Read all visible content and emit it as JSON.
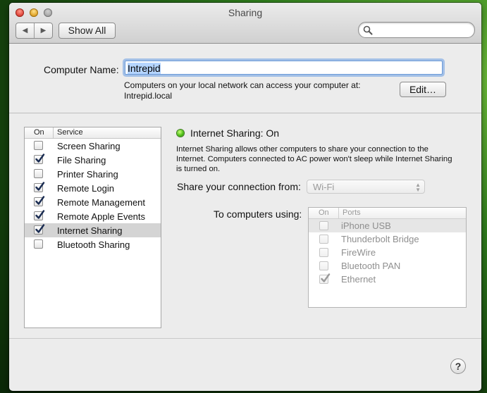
{
  "window": {
    "title": "Sharing"
  },
  "toolbar": {
    "back_icon": "back-arrow",
    "forward_icon": "forward-arrow",
    "show_all_label": "Show All",
    "search": {
      "value": "",
      "placeholder": ""
    }
  },
  "computer": {
    "label": "Computer Name:",
    "name": "Intrepid",
    "access_line1": "Computers on your local network can access your computer at:",
    "access_line2": "Intrepid.local",
    "edit_label": "Edit…"
  },
  "services": {
    "header_on": "On",
    "header_service": "Service",
    "items": [
      {
        "label": "Screen Sharing",
        "checked": false,
        "selected": false
      },
      {
        "label": "File Sharing",
        "checked": true,
        "selected": false
      },
      {
        "label": "Printer Sharing",
        "checked": false,
        "selected": false
      },
      {
        "label": "Remote Login",
        "checked": true,
        "selected": false
      },
      {
        "label": "Remote Management",
        "checked": true,
        "selected": false
      },
      {
        "label": "Remote Apple Events",
        "checked": true,
        "selected": false
      },
      {
        "label": "Internet Sharing",
        "checked": true,
        "selected": true
      },
      {
        "label": "Bluetooth Sharing",
        "checked": false,
        "selected": false
      }
    ]
  },
  "detail": {
    "status_title": "Internet Sharing: On",
    "status_color": "#4fbf18",
    "description": "Internet Sharing allows other computers to share your connection to the Internet. Computers connected to AC power won't sleep while Internet Sharing is turned on.",
    "share_from_label": "Share your connection from:",
    "share_from_value": "Wi-Fi",
    "to_computers_label": "To computers using:",
    "ports_header_on": "On",
    "ports_header_ports": "Ports",
    "ports": [
      {
        "label": "iPhone USB",
        "checked": false,
        "selected": true
      },
      {
        "label": "Thunderbolt Bridge",
        "checked": false,
        "selected": false
      },
      {
        "label": "FireWire",
        "checked": false,
        "selected": false
      },
      {
        "label": "Bluetooth PAN",
        "checked": false,
        "selected": false
      },
      {
        "label": "Ethernet",
        "checked": true,
        "selected": false
      }
    ]
  },
  "help": {
    "label": "?"
  }
}
